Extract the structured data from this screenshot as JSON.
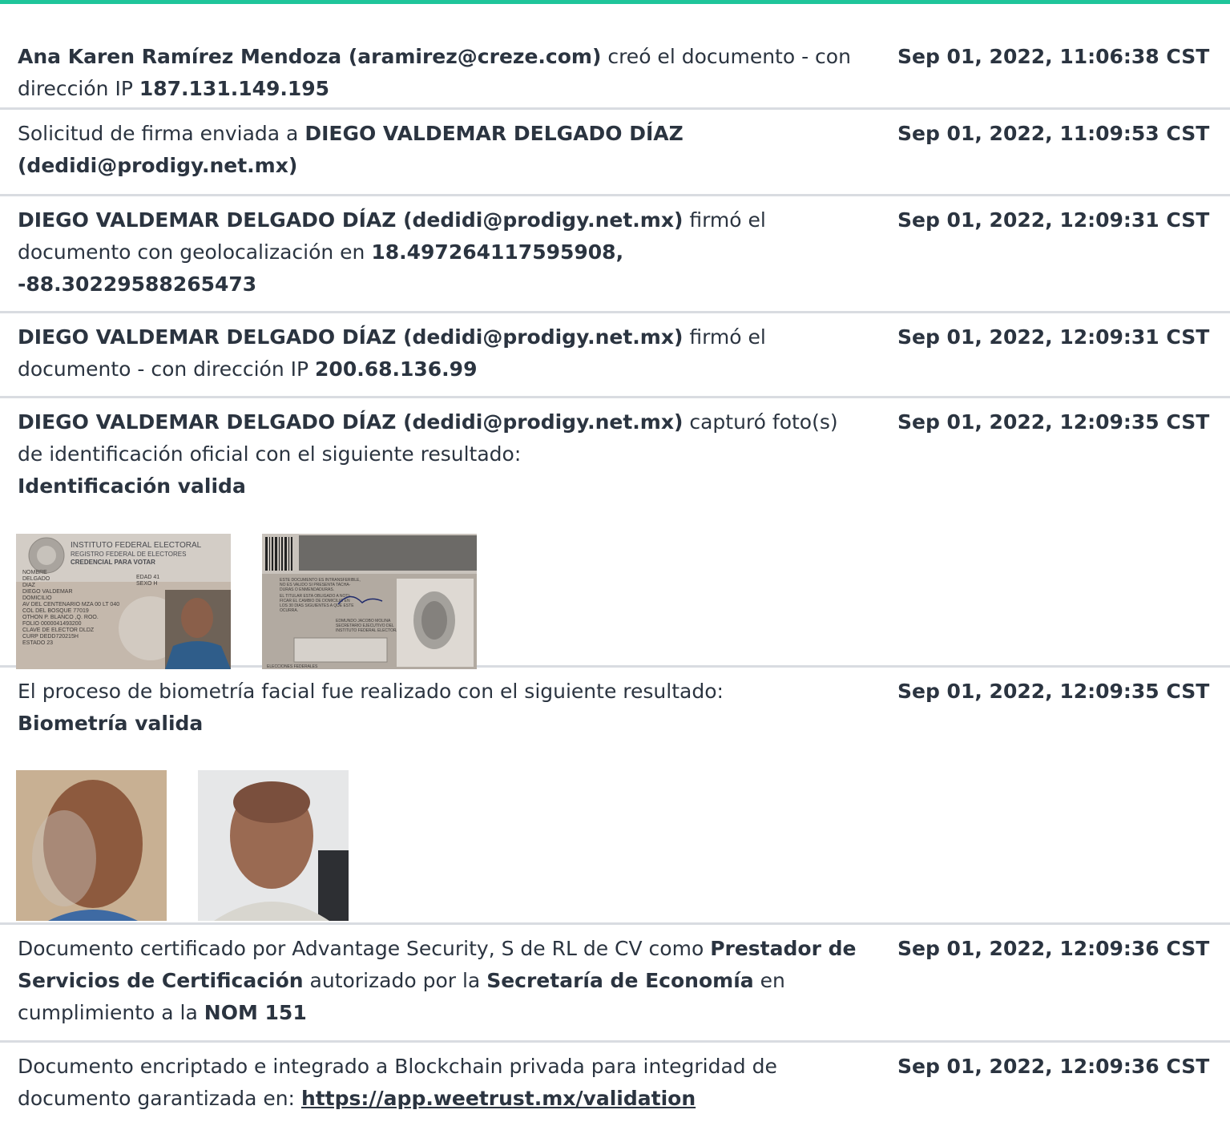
{
  "entries": [
    {
      "parts": [
        "Ana Karen Ramírez Mendoza (aramirez@creze.com)",
        " creó el documento - con dirección IP ",
        "187.131.149.195"
      ],
      "time": "Sep 01, 2022, 11:06:38 CST"
    },
    {
      "parts": [
        "Solicitud de firma enviada a ",
        "DIEGO VALDEMAR DELGADO DÍAZ (dedidi@prodigy.net.mx)"
      ],
      "time": "Sep 01, 2022, 11:09:53 CST"
    },
    {
      "parts": [
        "DIEGO VALDEMAR DELGADO DÍAZ (dedidi@prodigy.net.mx)",
        " firmó el documento con geolocalización en ",
        "18.497264117595908, -88.30229588265473"
      ],
      "time": "Sep 01, 2022, 12:09:31 CST"
    },
    {
      "parts": [
        "DIEGO VALDEMAR DELGADO DÍAZ (dedidi@prodigy.net.mx)",
        " firmó el documento - con dirección IP ",
        "200.68.136.99"
      ],
      "time": "Sep 01, 2022, 12:09:31 CST"
    },
    {
      "parts": [
        "DIEGO VALDEMAR DELGADO DÍAZ (dedidi@prodigy.net.mx)",
        " capturó foto(s) de identificación oficial con el siguiente resultado:",
        "Identificación valida"
      ],
      "time": "Sep 01, 2022, 12:09:35 CST",
      "id_front": {
        "title1": "INSTITUTO FEDERAL ELECTORAL",
        "title2": "REGISTRO FEDERAL DE ELECTORES",
        "title3": "CREDENCIAL PARA VOTAR",
        "lines": [
          "NOMBRE",
          "DELGADO",
          "DIAZ",
          "DIEGO VALDEMAR",
          "DOMICILIO",
          "AV DEL CENTENARIO MZA 00 LT 040",
          "COL DEL BOSQUE 77019",
          "OTHON P. BLANCO ,Q. ROO.",
          "FOLIO 0000041493200",
          "CLAVE DE ELECTOR DLDZ",
          "CURP DEDD720215H",
          "ESTADO 23"
        ],
        "edad": "EDAD 41",
        "sexo": "SEXO H"
      },
      "id_back": {
        "lines": [
          "ESTE DOCUMENTO ES INTRANSFERIBLE,",
          "NO ES VALIDO SI PRESENTA TACHA-",
          "DURAS O ENMENDADURAS.",
          "EL TITULAR ESTA OBLIGADO A NOTI-",
          "FICAR EL CAMBIO DE DOMICILIO EN",
          "LOS 30 DIAS SIGUIENTES A QUE ESTE",
          "OCURRA."
        ],
        "secretary": [
          "EDMUNDO JACOBO MOLINA",
          "SECRETARIO EJECUTIVO DEL",
          "INSTITUTO FEDERAL ELECTORAL"
        ],
        "footer": "ELECCIONES FEDERALES"
      }
    },
    {
      "parts": [
        "El proceso de biometría facial fue realizado con el siguiente resultado:",
        "Biometría valida"
      ],
      "time": "Sep 01, 2022, 12:09:35 CST"
    },
    {
      "parts": [
        "Documento certificado por Advantage Security, S de RL de CV como ",
        "Prestador de Servicios de Certificación",
        " autorizado por la ",
        "Secretaría de Economía",
        " en cumplimiento a la ",
        "NOM 151"
      ],
      "time": "Sep 01, 2022, 12:09:36 CST"
    },
    {
      "parts": [
        "Documento encriptado e integrado a Blockchain privada para integridad de documento garantizada en: ",
        "https://app.weetrust.mx/validation"
      ],
      "time": "Sep 01, 2022, 12:09:36 CST"
    }
  ],
  "colors": {
    "accent": "#1fc59a",
    "text": "#2b3440",
    "divider": "#d9dce1"
  }
}
